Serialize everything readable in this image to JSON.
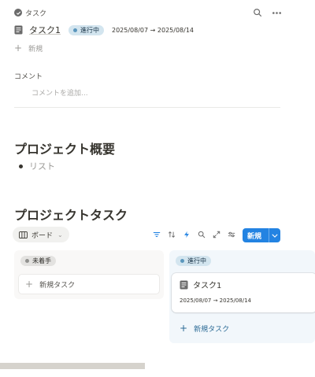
{
  "topbar": {
    "title": "タスク",
    "icons": [
      "check-circle-icon",
      "search-icon",
      "more-icon"
    ]
  },
  "task": {
    "name": "タスク1",
    "status": "進行中",
    "dates": "2025/08/07 → 2025/08/14"
  },
  "new_row": {
    "label": "新規"
  },
  "comments": {
    "label": "コメント",
    "placeholder": "コメントを追加..."
  },
  "overview": {
    "title": "プロジェクト概要",
    "bullet": "リスト"
  },
  "project_tasks": {
    "title": "プロジェクトタスク",
    "view_label": "ボード",
    "toolbar_icons": [
      "filter-icon",
      "sort-icon",
      "lightning-icon",
      "search-icon",
      "expand-icon",
      "settings-icon"
    ],
    "new_button": "新規",
    "columns": [
      {
        "status": "未着手",
        "cards": [],
        "add_label": "新規タスク"
      },
      {
        "status": "進行中",
        "cards": [
          {
            "title": "タスク1",
            "dates": "2025/08/07 → 2025/08/14"
          }
        ],
        "add_label": "新規タスク"
      }
    ]
  },
  "colors": {
    "accent": "#2383e2",
    "in_progress_bg": "#d3e5ef",
    "in_progress_dot": "#5b97bd",
    "todo_bg": "#e3e2e0"
  }
}
